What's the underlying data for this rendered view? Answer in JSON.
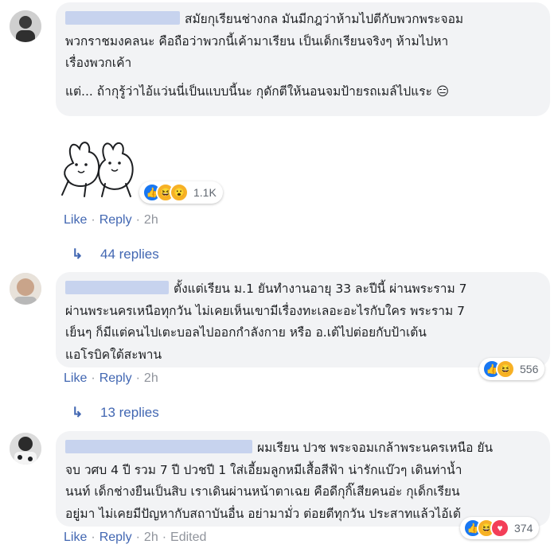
{
  "comments": [
    {
      "lines": [
        "สมัยกุเรียนช่างกล มันมีกฎว่าห้ามไปตีกับพวกพระจอม",
        "พวกราชมงคลนะ คือถือว่าพวกนี้เค้ามาเรียน เป็นเด็กเรียนจริงๆ ห้ามไปหา",
        "เรื่องพวกเค้า",
        "",
        "แต่... ถ้ากุรู้ว่าไอ้แว่นนี่เป็นแบบนี้นะ กุดักตีให้นอนจมป้ายรถเมล์ไปแระ"
      ],
      "emoji": "😑",
      "reaction_count": "1.1K",
      "actions": {
        "like": "Like",
        "reply": "Reply",
        "time": "2h"
      },
      "replies": "44 replies"
    },
    {
      "lines": [
        "ตั้งแต่เรียน ม.1 ยันทำงานอายุ 33 ละปีนี้ ผ่านพระราม 7",
        "ผ่านพระนครเหนือทุกวัน ไม่เคยเห็นเขามีเรื่องทะเลอะอะไรกับใคร พระราม 7",
        "เย็นๆ ก็มีแต่คนไปเตะบอลไปออกกำลังกาย หรือ อ.เต้ไปต่อยกับป้าเต้น",
        "แอโรบิคใต้สะพาน"
      ],
      "reaction_count": "556",
      "actions": {
        "like": "Like",
        "reply": "Reply",
        "time": "2h"
      },
      "replies": "13 replies"
    },
    {
      "lines": [
        "ผมเรียน ปวช พระจอมเกล้าพระนครเหนือ ยัน",
        "จบ วศบ 4 ปี รวม 7 ปี ปวชปี 1 ใส่เอี้ยมลูกหมีเสื้อสีฟ้า น่ารักแบ๊วๆ เดินท่าน้ำ",
        "นนท์ เด็กช่างยืนเป็นสิบ เราเดินผ่านหน้าตาเฉย คือดีกุกิ๊เสียคนอ่ะ กุเด็กเรียน",
        "อยู่มา ไม่เคยมีปัญหากับสถาบันอื่น อย่ามามั่ว ต่อยตีทุกวัน ประสาทแล้วไอ้เต้"
      ],
      "reaction_count": "374",
      "actions": {
        "like": "Like",
        "reply": "Reply",
        "time": "2h",
        "edited": "Edited"
      }
    }
  ],
  "colors": {
    "link": "#4267b2",
    "bubble": "#f2f3f5",
    "muted": "#90949c"
  },
  "icons": [
    "avatar",
    "reply-arrow-icon",
    "like-reaction-icon",
    "haha-reaction-icon",
    "wow-reaction-icon",
    "love-reaction-icon",
    "sticker"
  ]
}
